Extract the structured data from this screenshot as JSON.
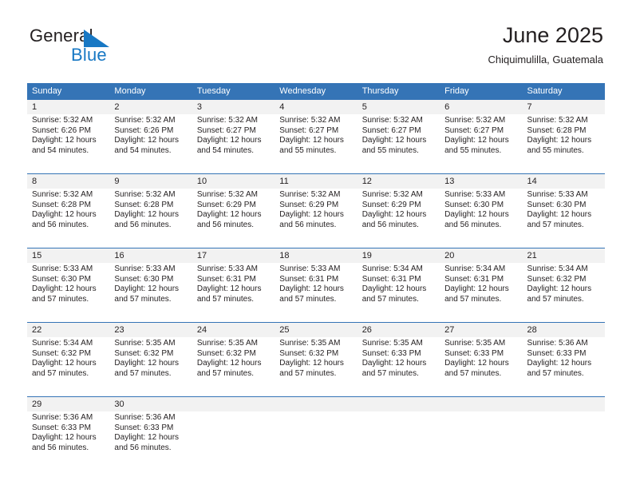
{
  "brand": {
    "name_part1": "General",
    "name_part2": "Blue",
    "flag_icon": "brand-flag-icon",
    "flag_color": "#1878c4"
  },
  "header": {
    "title": "June 2025",
    "subtitle": "Chiquimulilla, Guatemala"
  },
  "colors": {
    "header_blue": "#3574b6",
    "daynum_gray": "#f2f2f2",
    "text": "#231f20",
    "brand_blue": "#1878c4"
  },
  "weekday_headers": [
    "Sunday",
    "Monday",
    "Tuesday",
    "Wednesday",
    "Thursday",
    "Friday",
    "Saturday"
  ],
  "weeks": [
    {
      "days": [
        {
          "num": "1",
          "sunrise": "Sunrise: 5:32 AM",
          "sunset": "Sunset: 6:26 PM",
          "daylight_1": "Daylight: 12 hours",
          "daylight_2": "and 54 minutes."
        },
        {
          "num": "2",
          "sunrise": "Sunrise: 5:32 AM",
          "sunset": "Sunset: 6:26 PM",
          "daylight_1": "Daylight: 12 hours",
          "daylight_2": "and 54 minutes."
        },
        {
          "num": "3",
          "sunrise": "Sunrise: 5:32 AM",
          "sunset": "Sunset: 6:27 PM",
          "daylight_1": "Daylight: 12 hours",
          "daylight_2": "and 54 minutes."
        },
        {
          "num": "4",
          "sunrise": "Sunrise: 5:32 AM",
          "sunset": "Sunset: 6:27 PM",
          "daylight_1": "Daylight: 12 hours",
          "daylight_2": "and 55 minutes."
        },
        {
          "num": "5",
          "sunrise": "Sunrise: 5:32 AM",
          "sunset": "Sunset: 6:27 PM",
          "daylight_1": "Daylight: 12 hours",
          "daylight_2": "and 55 minutes."
        },
        {
          "num": "6",
          "sunrise": "Sunrise: 5:32 AM",
          "sunset": "Sunset: 6:27 PM",
          "daylight_1": "Daylight: 12 hours",
          "daylight_2": "and 55 minutes."
        },
        {
          "num": "7",
          "sunrise": "Sunrise: 5:32 AM",
          "sunset": "Sunset: 6:28 PM",
          "daylight_1": "Daylight: 12 hours",
          "daylight_2": "and 55 minutes."
        }
      ]
    },
    {
      "days": [
        {
          "num": "8",
          "sunrise": "Sunrise: 5:32 AM",
          "sunset": "Sunset: 6:28 PM",
          "daylight_1": "Daylight: 12 hours",
          "daylight_2": "and 56 minutes."
        },
        {
          "num": "9",
          "sunrise": "Sunrise: 5:32 AM",
          "sunset": "Sunset: 6:28 PM",
          "daylight_1": "Daylight: 12 hours",
          "daylight_2": "and 56 minutes."
        },
        {
          "num": "10",
          "sunrise": "Sunrise: 5:32 AM",
          "sunset": "Sunset: 6:29 PM",
          "daylight_1": "Daylight: 12 hours",
          "daylight_2": "and 56 minutes."
        },
        {
          "num": "11",
          "sunrise": "Sunrise: 5:32 AM",
          "sunset": "Sunset: 6:29 PM",
          "daylight_1": "Daylight: 12 hours",
          "daylight_2": "and 56 minutes."
        },
        {
          "num": "12",
          "sunrise": "Sunrise: 5:32 AM",
          "sunset": "Sunset: 6:29 PM",
          "daylight_1": "Daylight: 12 hours",
          "daylight_2": "and 56 minutes."
        },
        {
          "num": "13",
          "sunrise": "Sunrise: 5:33 AM",
          "sunset": "Sunset: 6:30 PM",
          "daylight_1": "Daylight: 12 hours",
          "daylight_2": "and 56 minutes."
        },
        {
          "num": "14",
          "sunrise": "Sunrise: 5:33 AM",
          "sunset": "Sunset: 6:30 PM",
          "daylight_1": "Daylight: 12 hours",
          "daylight_2": "and 57 minutes."
        }
      ]
    },
    {
      "days": [
        {
          "num": "15",
          "sunrise": "Sunrise: 5:33 AM",
          "sunset": "Sunset: 6:30 PM",
          "daylight_1": "Daylight: 12 hours",
          "daylight_2": "and 57 minutes."
        },
        {
          "num": "16",
          "sunrise": "Sunrise: 5:33 AM",
          "sunset": "Sunset: 6:30 PM",
          "daylight_1": "Daylight: 12 hours",
          "daylight_2": "and 57 minutes."
        },
        {
          "num": "17",
          "sunrise": "Sunrise: 5:33 AM",
          "sunset": "Sunset: 6:31 PM",
          "daylight_1": "Daylight: 12 hours",
          "daylight_2": "and 57 minutes."
        },
        {
          "num": "18",
          "sunrise": "Sunrise: 5:33 AM",
          "sunset": "Sunset: 6:31 PM",
          "daylight_1": "Daylight: 12 hours",
          "daylight_2": "and 57 minutes."
        },
        {
          "num": "19",
          "sunrise": "Sunrise: 5:34 AM",
          "sunset": "Sunset: 6:31 PM",
          "daylight_1": "Daylight: 12 hours",
          "daylight_2": "and 57 minutes."
        },
        {
          "num": "20",
          "sunrise": "Sunrise: 5:34 AM",
          "sunset": "Sunset: 6:31 PM",
          "daylight_1": "Daylight: 12 hours",
          "daylight_2": "and 57 minutes."
        },
        {
          "num": "21",
          "sunrise": "Sunrise: 5:34 AM",
          "sunset": "Sunset: 6:32 PM",
          "daylight_1": "Daylight: 12 hours",
          "daylight_2": "and 57 minutes."
        }
      ]
    },
    {
      "days": [
        {
          "num": "22",
          "sunrise": "Sunrise: 5:34 AM",
          "sunset": "Sunset: 6:32 PM",
          "daylight_1": "Daylight: 12 hours",
          "daylight_2": "and 57 minutes."
        },
        {
          "num": "23",
          "sunrise": "Sunrise: 5:35 AM",
          "sunset": "Sunset: 6:32 PM",
          "daylight_1": "Daylight: 12 hours",
          "daylight_2": "and 57 minutes."
        },
        {
          "num": "24",
          "sunrise": "Sunrise: 5:35 AM",
          "sunset": "Sunset: 6:32 PM",
          "daylight_1": "Daylight: 12 hours",
          "daylight_2": "and 57 minutes."
        },
        {
          "num": "25",
          "sunrise": "Sunrise: 5:35 AM",
          "sunset": "Sunset: 6:32 PM",
          "daylight_1": "Daylight: 12 hours",
          "daylight_2": "and 57 minutes."
        },
        {
          "num": "26",
          "sunrise": "Sunrise: 5:35 AM",
          "sunset": "Sunset: 6:33 PM",
          "daylight_1": "Daylight: 12 hours",
          "daylight_2": "and 57 minutes."
        },
        {
          "num": "27",
          "sunrise": "Sunrise: 5:35 AM",
          "sunset": "Sunset: 6:33 PM",
          "daylight_1": "Daylight: 12 hours",
          "daylight_2": "and 57 minutes."
        },
        {
          "num": "28",
          "sunrise": "Sunrise: 5:36 AM",
          "sunset": "Sunset: 6:33 PM",
          "daylight_1": "Daylight: 12 hours",
          "daylight_2": "and 57 minutes."
        }
      ]
    },
    {
      "days": [
        {
          "num": "29",
          "sunrise": "Sunrise: 5:36 AM",
          "sunset": "Sunset: 6:33 PM",
          "daylight_1": "Daylight: 12 hours",
          "daylight_2": "and 56 minutes."
        },
        {
          "num": "30",
          "sunrise": "Sunrise: 5:36 AM",
          "sunset": "Sunset: 6:33 PM",
          "daylight_1": "Daylight: 12 hours",
          "daylight_2": "and 56 minutes."
        },
        {
          "num": "",
          "sunrise": "",
          "sunset": "",
          "daylight_1": "",
          "daylight_2": ""
        },
        {
          "num": "",
          "sunrise": "",
          "sunset": "",
          "daylight_1": "",
          "daylight_2": ""
        },
        {
          "num": "",
          "sunrise": "",
          "sunset": "",
          "daylight_1": "",
          "daylight_2": ""
        },
        {
          "num": "",
          "sunrise": "",
          "sunset": "",
          "daylight_1": "",
          "daylight_2": ""
        },
        {
          "num": "",
          "sunrise": "",
          "sunset": "",
          "daylight_1": "",
          "daylight_2": ""
        }
      ]
    }
  ]
}
